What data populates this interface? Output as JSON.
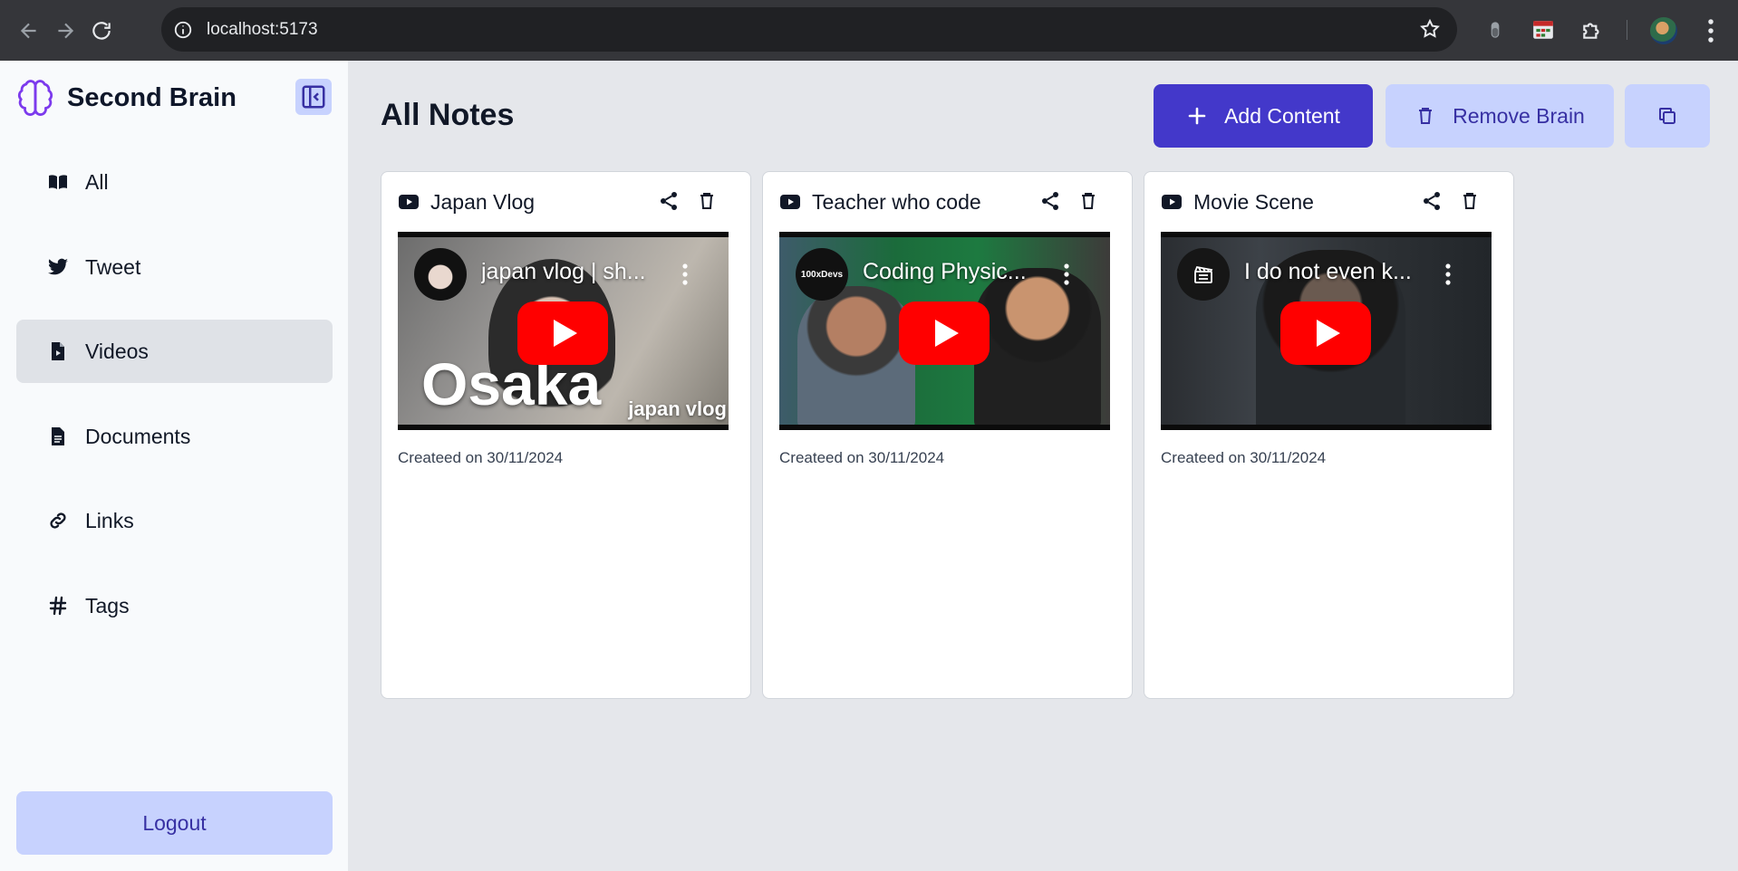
{
  "browser": {
    "url": "localhost:5173"
  },
  "sidebar": {
    "brand": "Second Brain",
    "items": [
      {
        "label": "All",
        "icon": "book-open-icon",
        "active": false
      },
      {
        "label": "Tweet",
        "icon": "twitter-icon",
        "active": false
      },
      {
        "label": "Videos",
        "icon": "file-video-icon",
        "active": true
      },
      {
        "label": "Documents",
        "icon": "file-text-icon",
        "active": false
      },
      {
        "label": "Links",
        "icon": "link-icon",
        "active": false
      },
      {
        "label": "Tags",
        "icon": "hash-icon",
        "active": false
      }
    ],
    "logout_label": "Logout"
  },
  "main": {
    "title": "All Notes",
    "add_label": "Add Content",
    "remove_label": "Remove Brain",
    "cards": [
      {
        "title": "Japan Vlog",
        "video_title": "japan vlog | sh...",
        "overlay_big": "Osaka",
        "overlay_small": "japan vlog",
        "date": "Createed on 30/11/2024"
      },
      {
        "title": "Teacher who code",
        "video_title": "Coding Physic...",
        "avatar_text": "100xDevs",
        "date": "Createed on 30/11/2024"
      },
      {
        "title": "Movie Scene",
        "video_title": "I do not even k...",
        "date": "Createed on 30/11/2024"
      }
    ]
  },
  "colors": {
    "primary": "#4338ca",
    "primary_light": "#c7d2fe",
    "brand_icon": "#7c3aed",
    "active_bg": "#dfe2e7",
    "youtube_red": "#ff0000"
  }
}
